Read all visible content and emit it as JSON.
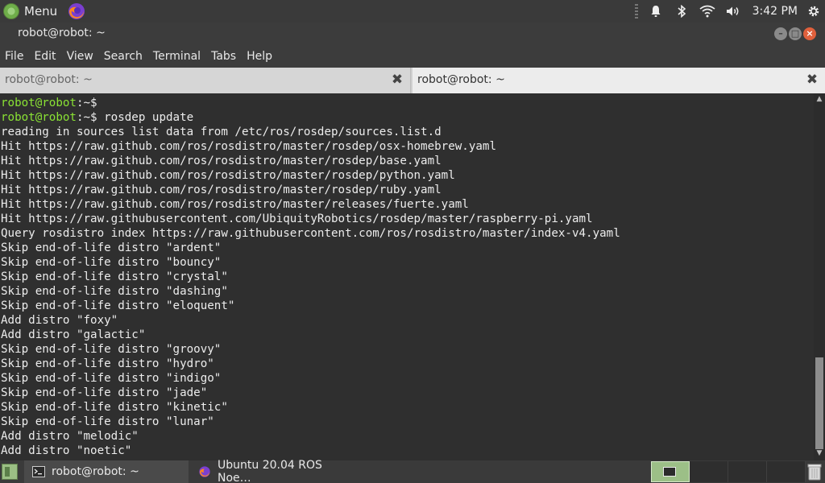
{
  "top_panel": {
    "menu_label": "Menu",
    "clock": "3:42 PM",
    "tray_icons": [
      "bell-icon",
      "bluetooth-icon",
      "wifi-icon",
      "volume-icon",
      "gear-icon"
    ]
  },
  "window": {
    "title": "robot@robot: ~"
  },
  "menubar": {
    "items": [
      "File",
      "Edit",
      "View",
      "Search",
      "Terminal",
      "Tabs",
      "Help"
    ]
  },
  "tabs": [
    {
      "label": "robot@robot: ~",
      "active": false
    },
    {
      "label": "robot@robot: ~",
      "active": true
    }
  ],
  "terminal": {
    "prompt": "robot@robot",
    "lines": [
      {
        "prompt": "robot@robot",
        "suffix": ":~$",
        "text": ""
      },
      {
        "prompt": "robot@robot",
        "suffix": ":~$",
        "text": " rosdep update"
      },
      {
        "text": "reading in sources list data from /etc/ros/rosdep/sources.list.d"
      },
      {
        "text": "Hit https://raw.github.com/ros/rosdistro/master/rosdep/osx-homebrew.yaml"
      },
      {
        "text": "Hit https://raw.github.com/ros/rosdistro/master/rosdep/base.yaml"
      },
      {
        "text": "Hit https://raw.github.com/ros/rosdistro/master/rosdep/python.yaml"
      },
      {
        "text": "Hit https://raw.github.com/ros/rosdistro/master/rosdep/ruby.yaml"
      },
      {
        "text": "Hit https://raw.github.com/ros/rosdistro/master/releases/fuerte.yaml"
      },
      {
        "text": "Hit https://raw.githubusercontent.com/UbiquityRobotics/rosdep/master/raspberry-pi.yaml"
      },
      {
        "text": "Query rosdistro index https://raw.githubusercontent.com/ros/rosdistro/master/index-v4.yaml"
      },
      {
        "text": "Skip end-of-life distro \"ardent\""
      },
      {
        "text": "Skip end-of-life distro \"bouncy\""
      },
      {
        "text": "Skip end-of-life distro \"crystal\""
      },
      {
        "text": "Skip end-of-life distro \"dashing\""
      },
      {
        "text": "Skip end-of-life distro \"eloquent\""
      },
      {
        "text": "Add distro \"foxy\""
      },
      {
        "text": "Add distro \"galactic\""
      },
      {
        "text": "Skip end-of-life distro \"groovy\""
      },
      {
        "text": "Skip end-of-life distro \"hydro\""
      },
      {
        "text": "Skip end-of-life distro \"indigo\""
      },
      {
        "text": "Skip end-of-life distro \"jade\""
      },
      {
        "text": "Skip end-of-life distro \"kinetic\""
      },
      {
        "text": "Skip end-of-life distro \"lunar\""
      },
      {
        "text": "Add distro \"melodic\""
      },
      {
        "text": "Add distro \"noetic\""
      }
    ]
  },
  "taskbar": {
    "tasks": [
      {
        "label": "robot@robot: ~",
        "icon": "terminal-icon",
        "active": true
      },
      {
        "label": "Ubuntu 20.04 ROS Noe…",
        "icon": "firefox-icon",
        "active": false
      }
    ],
    "workspaces": 4,
    "active_workspace": 1
  },
  "colors": {
    "prompt": "#8ae234",
    "terminal_bg": "#2f2f2f",
    "close_button": "#e0603c"
  }
}
